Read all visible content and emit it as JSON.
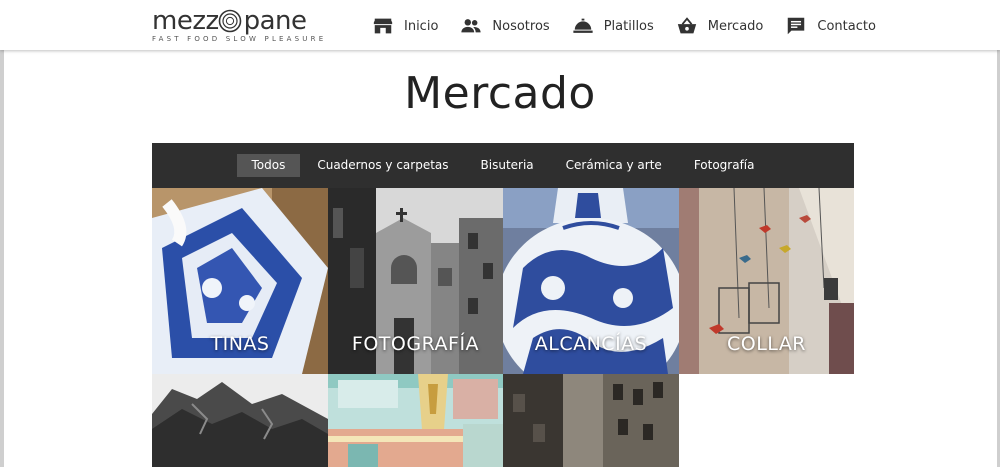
{
  "header": {
    "logo": {
      "word_before": "mezz",
      "word_after": "pane",
      "tagline": "FAST FOOD SLOW PLEASURE"
    },
    "nav": [
      {
        "label": "Inicio",
        "icon": "store-icon"
      },
      {
        "label": "Nosotros",
        "icon": "people-icon"
      },
      {
        "label": "Platillos",
        "icon": "cloche-icon"
      },
      {
        "label": "Mercado",
        "icon": "basket-icon"
      },
      {
        "label": "Contacto",
        "icon": "chat-bubble-icon"
      }
    ]
  },
  "page_title": "Mercado",
  "filters": [
    {
      "label": "Todos",
      "active": true
    },
    {
      "label": "Cuadernos y carpetas",
      "active": false
    },
    {
      "label": "Bisuteria",
      "active": false
    },
    {
      "label": "Cerámica y arte",
      "active": false
    },
    {
      "label": "Fotografía",
      "active": false
    }
  ],
  "products": [
    {
      "label": "TINAS",
      "image": "blue-white-ceramic-box-photo"
    },
    {
      "label": "FOTOGRAFÍA",
      "image": "black-white-church-street-photo"
    },
    {
      "label": "ALCANCÍAS",
      "image": "blue-white-ceramic-jar-photo"
    },
    {
      "label": "COLLAR",
      "image": "bird-necklaces-hanging-photo"
    },
    {
      "label": "",
      "image": "mountain-black-white-photo"
    },
    {
      "label": "",
      "image": "pastel-market-stall-photo"
    },
    {
      "label": "",
      "image": "narrow-alley-buildings-photo"
    }
  ],
  "colors": {
    "filter_bar": "#2f2f2f",
    "filter_active": "#555555",
    "text_dark": "#222222"
  }
}
